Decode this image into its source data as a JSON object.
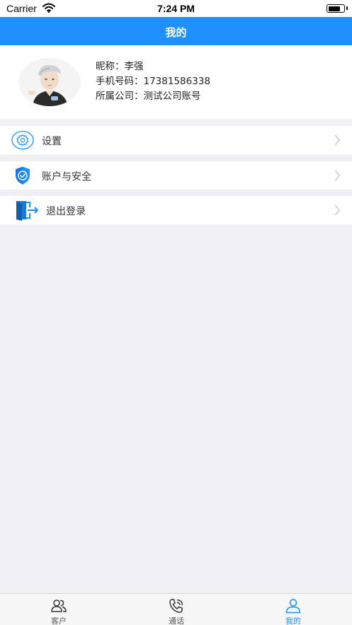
{
  "status": {
    "carrier": "Carrier",
    "time": "7:24 PM",
    "battery_level": 0.8
  },
  "nav": {
    "title": "我的"
  },
  "profile": {
    "nickname": "昵称：李强",
    "phone": "手机号码：17381586338",
    "company": "所属公司：测试公司账号"
  },
  "menu": [
    {
      "label": "设置",
      "icon": "gear-icon"
    },
    {
      "label": "账户与安全",
      "icon": "shield-icon"
    },
    {
      "label": "退出登录",
      "icon": "logout-icon"
    }
  ],
  "tabs": [
    {
      "label": "客户",
      "icon": "customers-icon"
    },
    {
      "label": "通话",
      "icon": "phone-icon"
    },
    {
      "label": "我的",
      "icon": "user-icon",
      "active": true
    }
  ],
  "colors": {
    "accent": "#1e90ff",
    "background": "#efeff4"
  }
}
